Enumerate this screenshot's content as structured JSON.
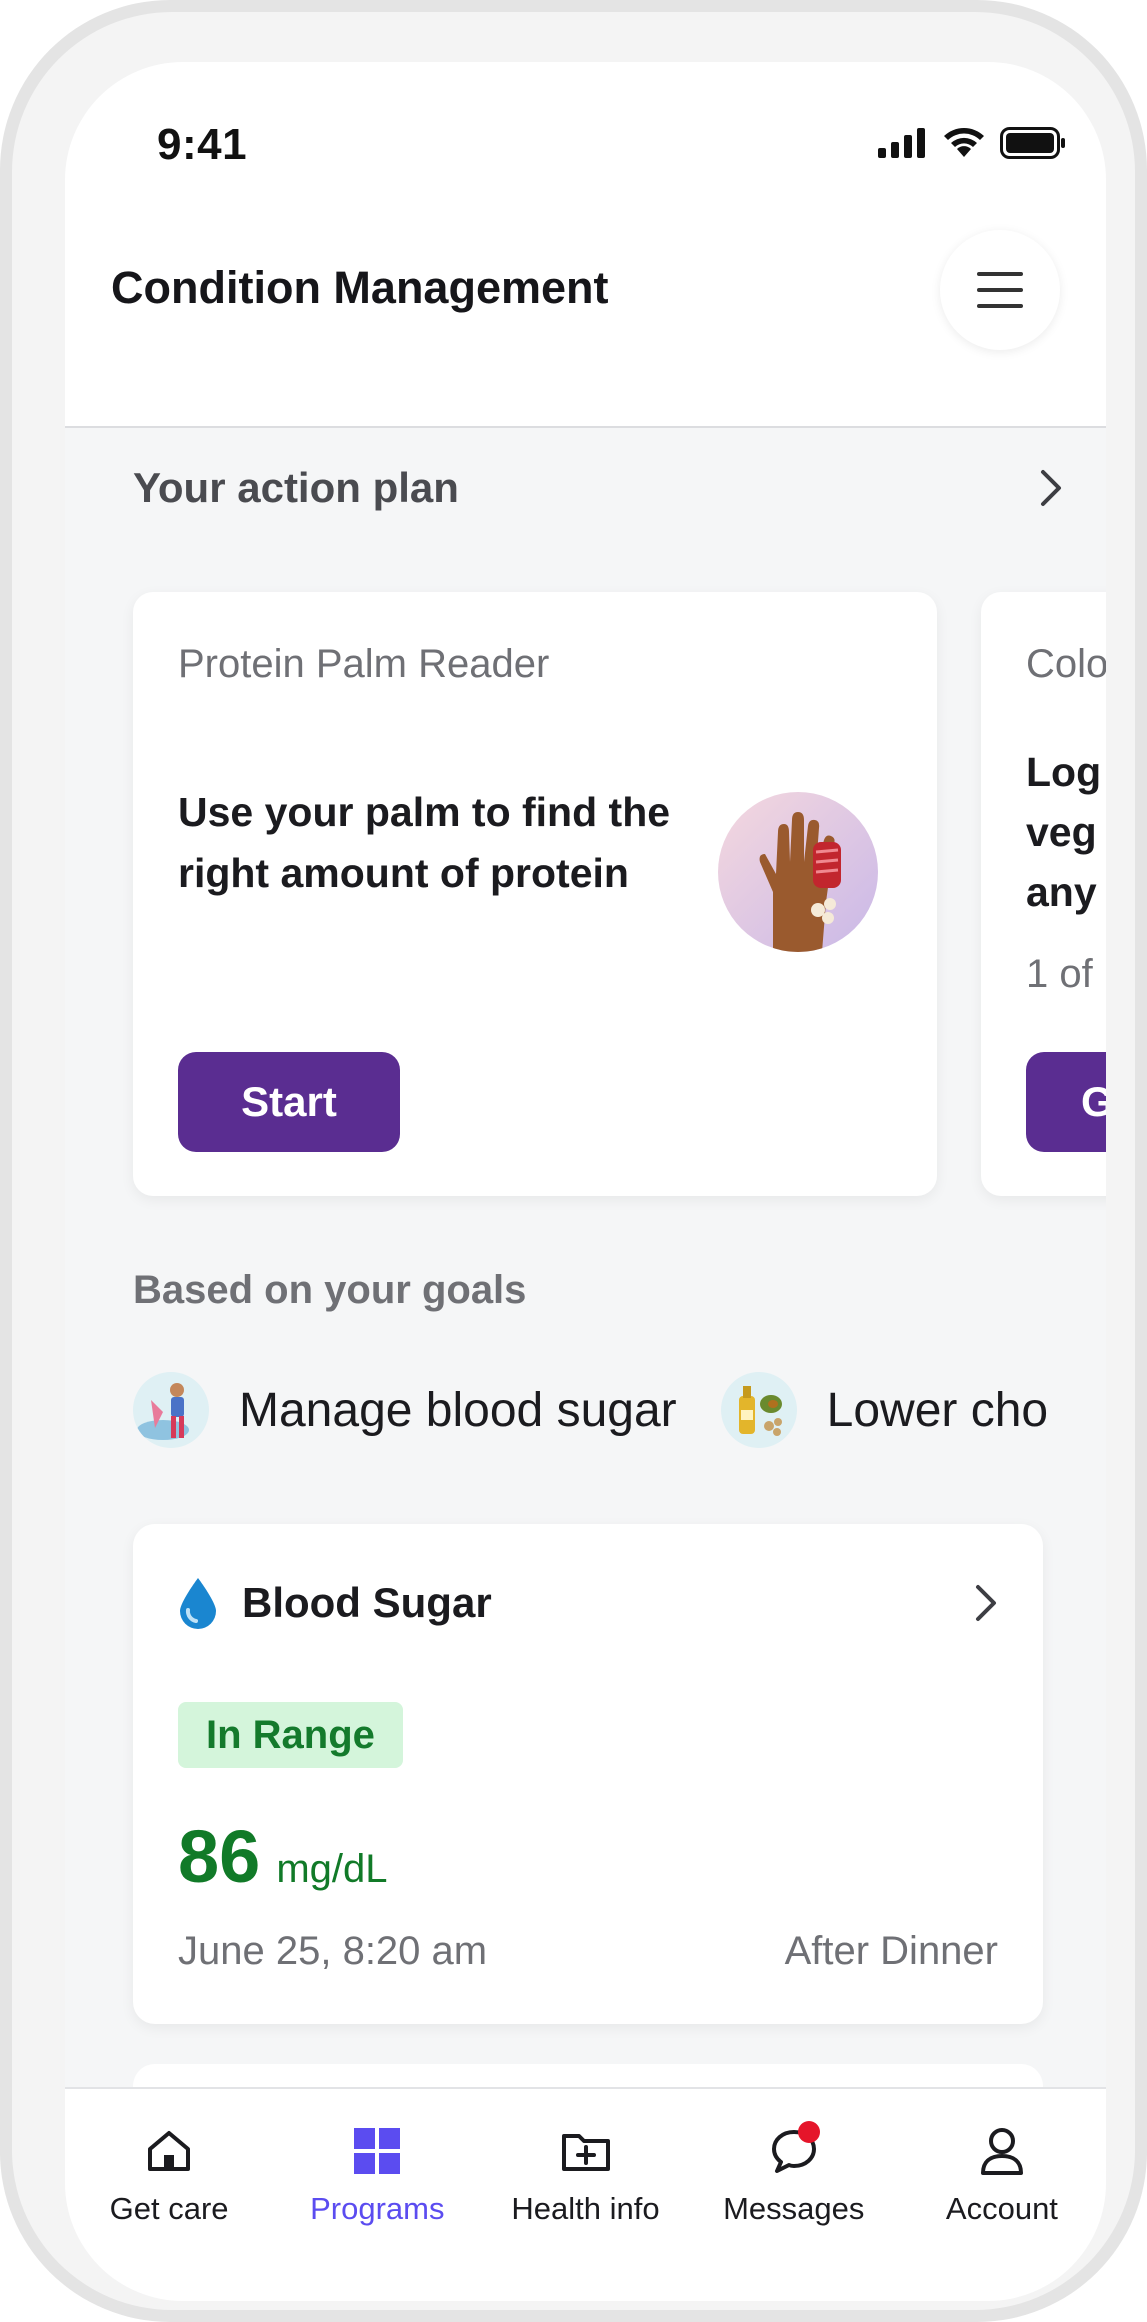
{
  "status_bar": {
    "time": "9:41",
    "icons": [
      "signal-icon",
      "wifi-icon",
      "battery-icon"
    ]
  },
  "header": {
    "title": "Condition Management",
    "menu_icon": "menu-icon"
  },
  "action_plan": {
    "label": "Your action plan",
    "cards": [
      {
        "kicker": "Protein Palm Reader",
        "body": "Use your palm to find the right amount of protein",
        "button": "Start"
      },
      {
        "kicker": "Colo",
        "body_lines": [
          "Log",
          "veg",
          "any"
        ],
        "progress": "1 of",
        "button": "G"
      }
    ]
  },
  "goals": {
    "label": "Based on your goals",
    "items": [
      {
        "label": "Manage blood sugar"
      },
      {
        "label": "Lower cho"
      }
    ]
  },
  "blood_sugar": {
    "title": "Blood Sugar",
    "status": "In Range",
    "value": "86",
    "unit": "mg/dL",
    "date": "June 25, 8:20 am",
    "context": "After Dinner"
  },
  "bottom_nav": [
    {
      "label": "Get care",
      "icon": "home-icon"
    },
    {
      "label": "Programs",
      "icon": "grid-icon",
      "active": true
    },
    {
      "label": "Health info",
      "icon": "folder-plus-icon"
    },
    {
      "label": "Messages",
      "icon": "chat-bubble-icon",
      "badge": true
    },
    {
      "label": "Account",
      "icon": "person-icon"
    }
  ],
  "colors": {
    "accent_purple": "#5a2d91",
    "nav_active": "#5b4cf0",
    "in_range_green": "#117a28",
    "badge_bg": "#d4f5db",
    "notification_red": "#e5152a"
  }
}
